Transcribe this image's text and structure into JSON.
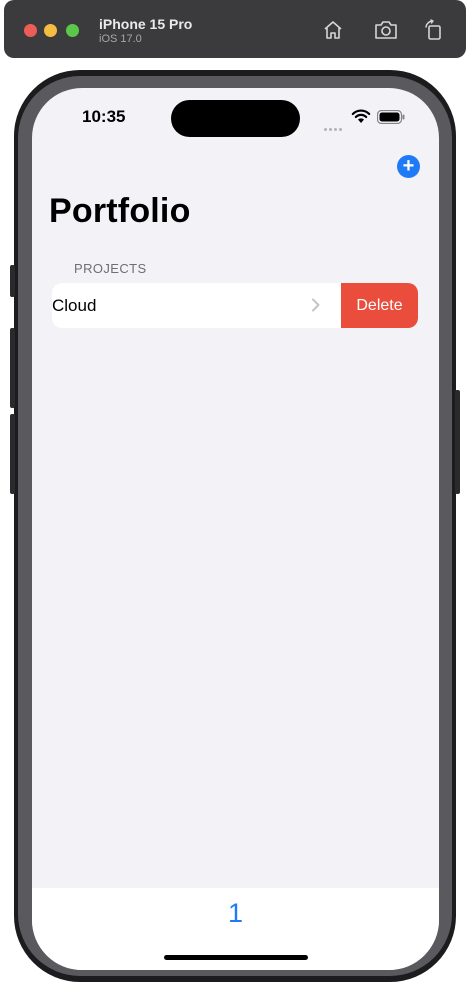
{
  "simulator": {
    "device_name": "iPhone 15 Pro",
    "os_version": "iOS 17.0",
    "toolbar": [
      "home-icon",
      "screenshot-icon",
      "rotate-icon"
    ]
  },
  "status_bar": {
    "time": "10:35"
  },
  "nav": {
    "title": "Portfolio",
    "add_icon": "+"
  },
  "list": {
    "section_header": "PROJECTS",
    "rows": [
      {
        "label": "Cloud",
        "action": "Delete"
      }
    ]
  },
  "tab_bar": {
    "items": [
      "1"
    ]
  },
  "colors": {
    "accent": "#1f7bf5",
    "destructive": "#eb4d3d",
    "background": "#f2f2f7"
  }
}
